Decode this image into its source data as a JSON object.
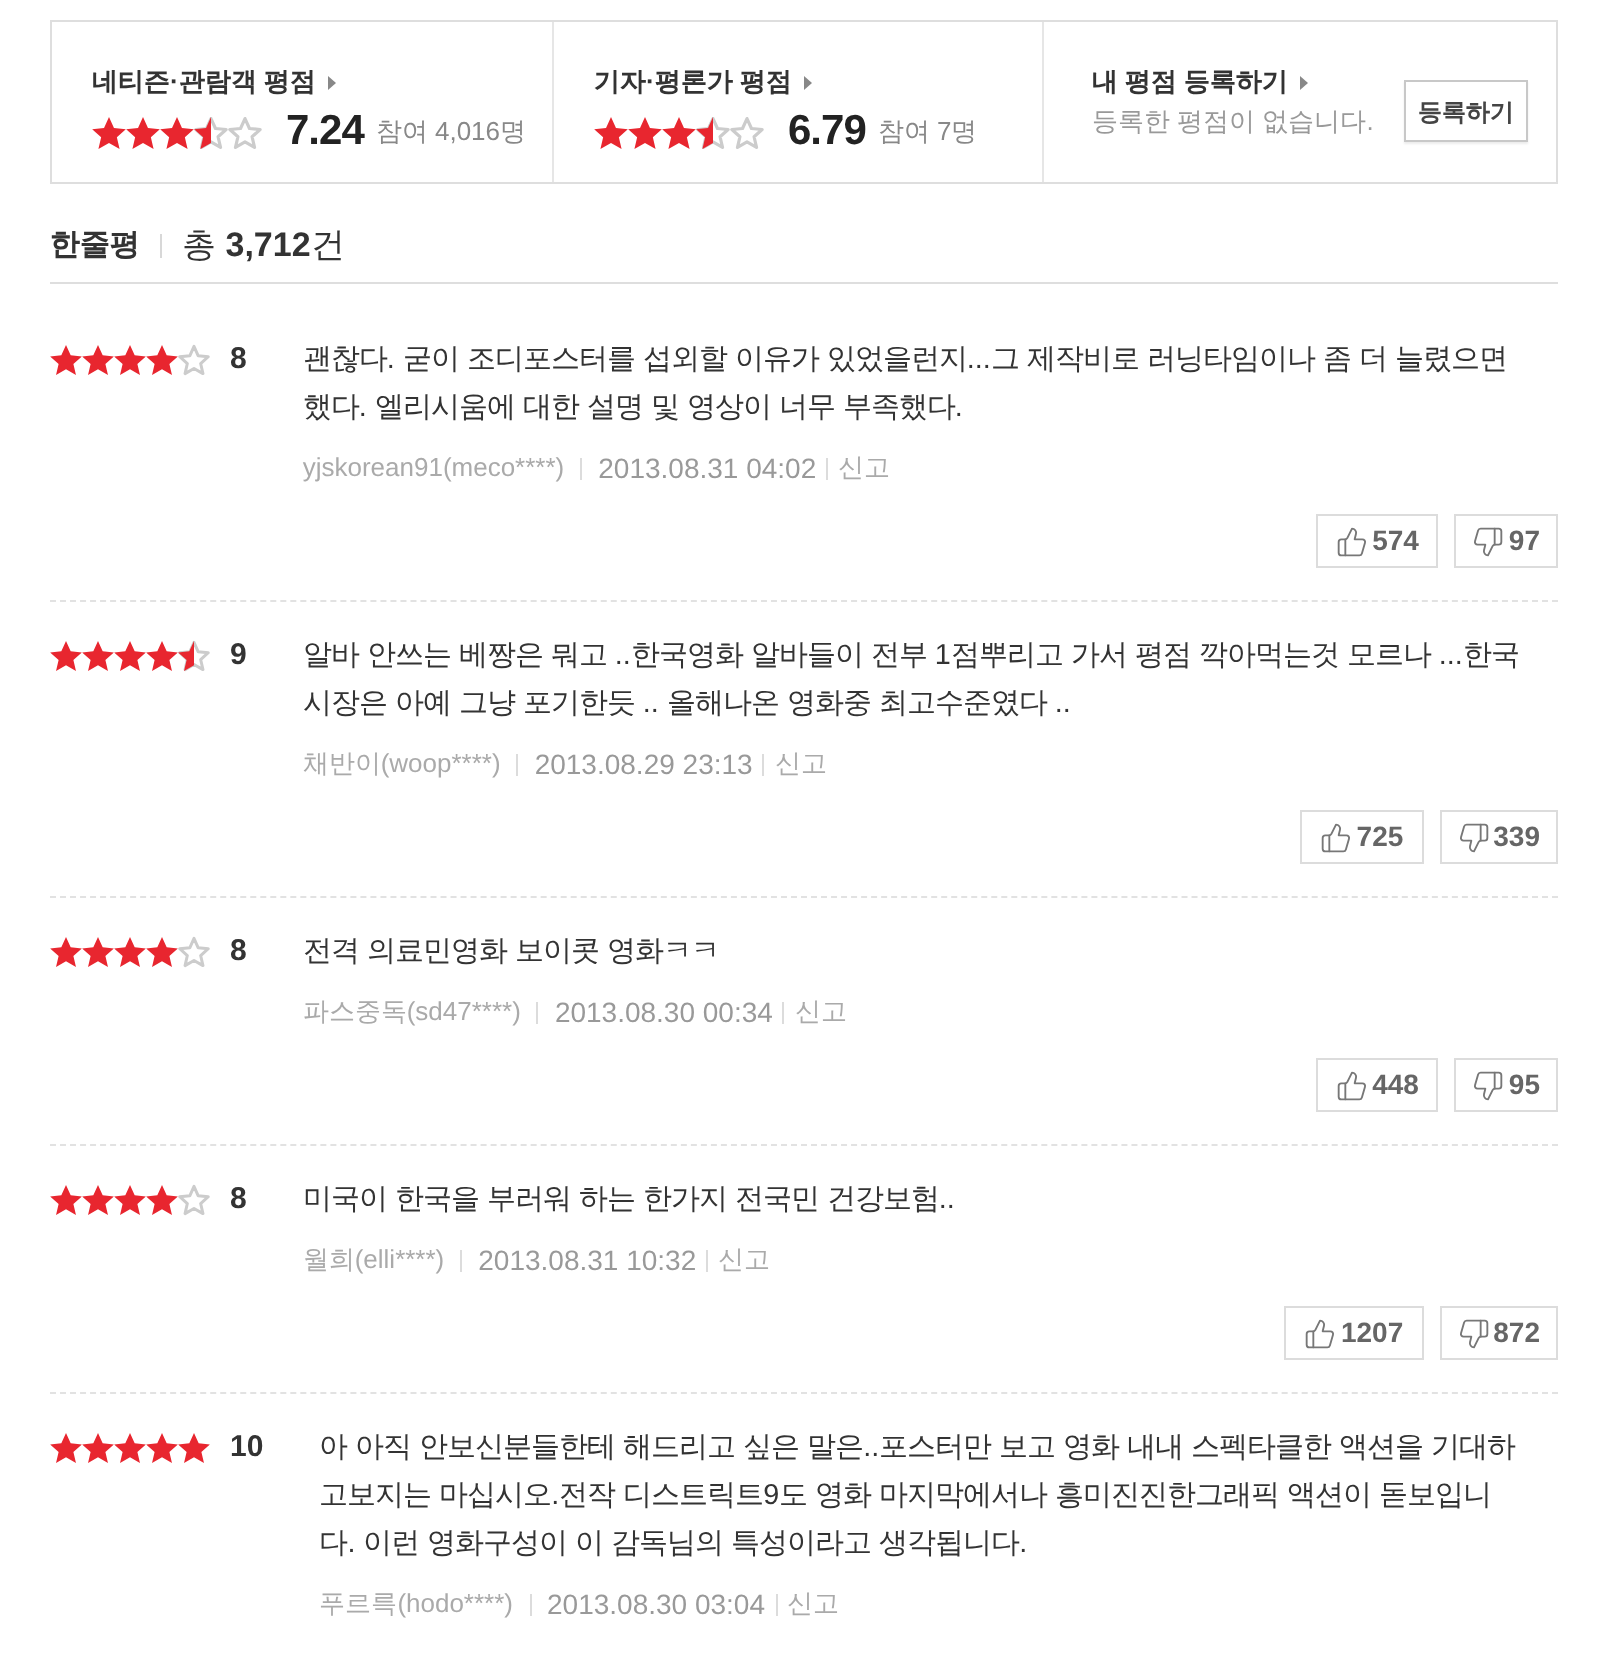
{
  "ratings_summary": [
    {
      "kind": "score",
      "title": "네티즌·관람객 평점",
      "stars": 3.5,
      "score": "7.24",
      "participants": "참여 4,016명"
    },
    {
      "kind": "score",
      "title": "기자·평론가 평점",
      "stars": 3.5,
      "score": "6.79",
      "participants": "참여 7명"
    },
    {
      "kind": "register",
      "title": "내 평점 등록하기",
      "message": "등록한 평점이 없습니다.",
      "button": "등록하기"
    }
  ],
  "reviews_header": {
    "title": "한줄평",
    "total": "총 **3,712**건"
  },
  "reviews": [
    {
      "stars": 4,
      "score": "8",
      "text": "괜찮다. 굳이 조디포스터를 섭외할 이유가 있었을런지...그 제작비로 러닝타임이나 좀 더 늘렸으면 했다. 엘리시움에 대한 설명 및 영상이 너무 부족했다.",
      "author": "yjskorean91(meco****)",
      "date": "2013.08.31 04:02",
      "report": "신고",
      "likes": "574",
      "dislikes": "97"
    },
    {
      "stars": 4.5,
      "score": "9",
      "text": "알바 안쓰는 베짱은 뭐고 ..한국영화 알바들이 전부 1점뿌리고 가서 평점 깍아먹는것 모르나 ...한국시장은 아예 그냥 포기한듯 .. 올해나온 영화중 최고수준였다 ..",
      "author": "채반이(woop****)",
      "date": "2013.08.29 23:13",
      "report": "신고",
      "likes": "725",
      "dislikes": "339"
    },
    {
      "stars": 4,
      "score": "8",
      "text": "전격 의료민영화 보이콧 영화ㅋㅋ",
      "author": "파스중독(sd47****)",
      "date": "2013.08.30 00:34",
      "report": "신고",
      "likes": "448",
      "dislikes": "95"
    },
    {
      "stars": 4,
      "score": "8",
      "text": "미국이 한국을 부러워 하는 한가지 전국민 건강보험..",
      "author": "월희(elli****)",
      "date": "2013.08.31 10:32",
      "report": "신고",
      "likes": "1207",
      "dislikes": "872"
    },
    {
      "stars": 5,
      "score": "10",
      "text": "아 아직 안보신분들한테 해드리고 싶은 말은..포스터만 보고 영화 내내 스펙타클한 액션을 기대하고보지는 마십시오.전작 디스트릭트9도 영화 마지막에서나 흥미진진한그래픽 액션이 돋보입니다. 이런 영화구성이 이 감독님의 특성이라고 생각됩니다.",
      "author": "푸르륵(hodo****)",
      "date": "2013.08.30 03:04",
      "report": "신고"
    }
  ]
}
